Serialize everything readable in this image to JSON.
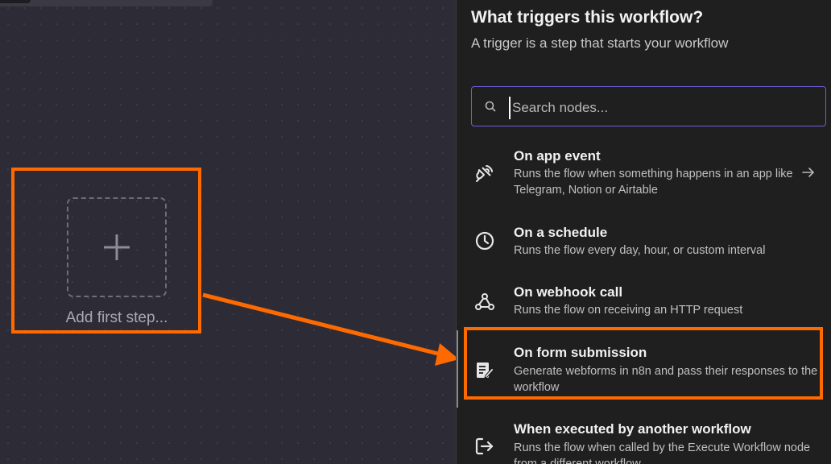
{
  "canvas": {
    "add_first_step_label": "Add first step..."
  },
  "panel": {
    "title": "What triggers this workflow?",
    "subtitle": "A trigger is a step that starts your workflow",
    "search": {
      "placeholder": "Search nodes...",
      "value": ""
    },
    "items": [
      {
        "title": "On app event",
        "description": "Runs the flow when something happens in an app like Telegram, Notion or Airtable",
        "icon": "app-event-icon",
        "has_arrow": true
      },
      {
        "title": "On a schedule",
        "description": "Runs the flow every day, hour, or custom interval",
        "icon": "clock-icon"
      },
      {
        "title": "On webhook call",
        "description": "Runs the flow on receiving an HTTP request",
        "icon": "webhook-icon"
      },
      {
        "title": "On form submission",
        "description": "Generate webforms in n8n and pass their responses to the workflow",
        "icon": "form-icon",
        "highlighted": true
      },
      {
        "title": "When executed by another workflow",
        "description": "Runs the flow when called by the Execute Workflow node from a different workflow",
        "icon": "sign-in-icon"
      }
    ]
  },
  "colors": {
    "highlight": "#ff6a00",
    "search_border": "#6b5fd6",
    "panel_bg": "#1f1f1f",
    "canvas_bg": "#2d2c36"
  }
}
